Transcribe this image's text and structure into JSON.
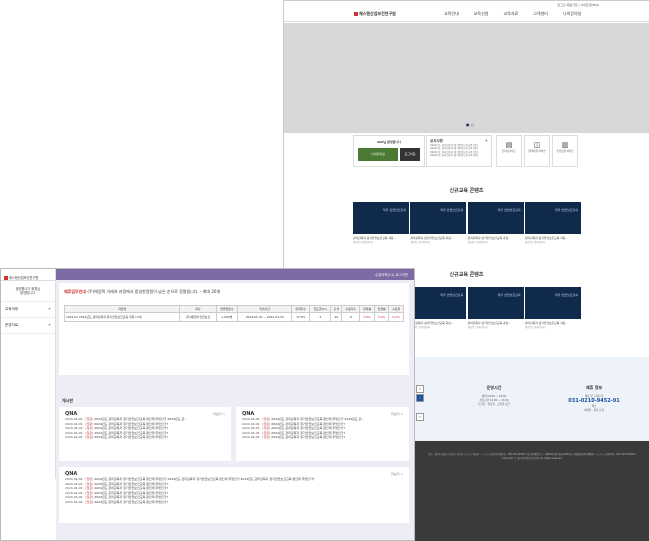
{
  "back": {
    "util": "로그인 회원가입 | 사이트맵    ENG",
    "logo": "제스텐산업보건연구원",
    "menu": [
      "교육안내",
      "교육신청",
      "교육자료",
      "고객센터",
      "나의강의실"
    ],
    "dots": "● ○",
    "quick1": {
      "title": "000님 환영합니다",
      "btn1": "나의강의실",
      "btn2": "로그아웃"
    },
    "quick2": {
      "title": "공지사항",
      "plus": "+",
      "lines": [
        "2024년도 관리감독자 정기안전보건교육 안내",
        "2024년도 관리감독자 정기안전보건교육 안내",
        "2024년도 관리감독자 정기안전보건교육 안내",
        "2024년도 관리감독자 정기안전보건교육 안내"
      ]
    },
    "icons": [
      {
        "glyph": "▤",
        "label": "온라인가이드"
      },
      {
        "glyph": "◫",
        "label": "원격지원 서비스"
      },
      {
        "glyph": "▥",
        "label": "수강신청 서비스"
      }
    ],
    "section1": "신규교육 콘텐츠",
    "section2": "신규교육 콘텐츠",
    "thumbs": [
      {
        "badge": "직무 안전보건교육",
        "cap": "관리감독자 정기안전보건교육 과정...",
        "sub": "제조업 | 관리감독자"
      },
      {
        "badge": "직무 안전보건교육",
        "cap": "관리감독자 정기안전보건교육 과정...",
        "sub": "제조업 | 관리감독자"
      },
      {
        "badge": "직무 안전보건교육",
        "cap": "관리감독자 정기안전보건교육 과정...",
        "sub": "제조업 | 관리감독자"
      },
      {
        "badge": "직무 안전보건교육",
        "cap": "관리감독자 정기안전보건교육 과정...",
        "sub": "제조업 | 관리감독자"
      }
    ],
    "foot": {
      "hours_title": "운영시간",
      "hours_lines": [
        "평일 09:00 ~ 18:00",
        "점심시간 12:00 ~ 13:00",
        "토요일 · 일요일 · 공휴일 휴무"
      ],
      "contact_title": "제휴 정보",
      "contact_sub": "제휴 및 고객문의",
      "tel": "031-0210-9452-91",
      "contact_lines": [
        "팩스",
        "이메일 · 카톡 문의"
      ],
      "dark": "주소 : 경기도 성남시 분당구 판교로 ○○○ | 대표자 : ○○○ | 사업자등록번호 : 000-00-00000 | 통신판매업신고 : 제0000-경기성남-0000호 | 개인정보관리책임자 : ○○○ | 교육문의 : 031-0210-9452 | Copyright ⓒ 제스텐산업보건연구원 All rights reserved."
    }
  },
  "front": {
    "sb_logo": "제스텐산업보건연구원",
    "sb_user": [
      "환영합니다 회원님",
      "환영합니다."
    ],
    "sb_items": [
      {
        "label": "교육과정",
        "sign": "+"
      },
      {
        "label": "운영자료",
        "sign": "+"
      }
    ],
    "topbar_right": "수강이력(11)    로그아웃",
    "notice_prefix": "제휴업무안내",
    "notice_text": "(주)에임텍 거래처 과정에서 합성한정원이 낮은 순으로 정렬됩니다. - 최대 20개",
    "table": {
      "headers": [
        "과정명",
        "회사",
        "연결정원수",
        "학습기간",
        "합격자수",
        "진도율(%)",
        "출석",
        "수료자수",
        "합격률",
        "진행률",
        "수료율"
      ],
      "row": [
        "2024-01 2024년도 관리감독자 정기안전보건교육 과정 (1차)",
        "(주)에임텍 안전보건",
        "1,000명",
        "2024-01-01 ~ 2024-04-30",
        "17.8%",
        "4",
        "29",
        "8",
        "0.0%",
        "0.0%",
        "0.0%"
      ]
    },
    "board_title": "게시판",
    "boards": [
      {
        "title": "QNA",
        "more": "더보기 >",
        "rows": [
          {
            "date": "2024-04-09",
            "tag": "[질문]",
            "text": "2024년도 관리감독자 정기안전보건교육 편인데 무엇인가 2024년도 관..."
          },
          {
            "date": "2024-04-09",
            "tag": "[질문]",
            "text": "2024년도 관리감독자 정기안전보건교육 편인데 무엇인가?"
          },
          {
            "date": "2024-04-09",
            "tag": "[질문]",
            "text": "2024년도 관리감독자 정기안전보건교육 편인데 무엇인가?"
          },
          {
            "date": "2024-04-09",
            "tag": "[질문]",
            "text": "2024년도 관리감독자 정기안전보건교육 편인데 무엇인가?"
          },
          {
            "date": "2024-04-09",
            "tag": "[질문]",
            "text": "2024년도 관리감독자 정기안전보건교육 편인데 무엇인가?"
          }
        ]
      },
      {
        "title": "QNA",
        "more": "더보기 >",
        "rows": [
          {
            "date": "2024-04-09",
            "tag": "[질문]",
            "text": "2024년도 관리감독자 정기안전보건교육 편인데 무엇인가 2024년도 관..."
          },
          {
            "date": "2024-04-09",
            "tag": "[질문]",
            "text": "2024년도 관리감독자 정기안전보건교육 편인데 무엇인가?"
          },
          {
            "date": "2024-04-09",
            "tag": "[질문]",
            "text": "2024년도 관리감독자 정기안전보건교육 편인데 무엇인가?"
          },
          {
            "date": "2024-04-09",
            "tag": "[질문]",
            "text": "2024년도 관리감독자 정기안전보건교육 편인데 무엇인가?"
          },
          {
            "date": "2024-04-09",
            "tag": "[질문]",
            "text": "2024년도 관리감독자 정기안전보건교육 편인데 무엇인가?"
          }
        ]
      },
      {
        "title": "QNA",
        "more": "더보기 >",
        "rows": [
          {
            "date": "2024-04-09",
            "tag": "[질문]",
            "text": "2024년도 관리감독자 정기안전보건교육 편인데 무엇인가 2024년도 관리감독자 정기안전보건교육 편인데 무엇인가 2024년도 관리감독자 정기안전보건교육 편인데 무엇인가?"
          },
          {
            "date": "2024-04-09",
            "tag": "[질문]",
            "text": "2024년도 관리감독자 정기안전보건교육 편인데 무엇인가?"
          },
          {
            "date": "2024-04-09",
            "tag": "[질문]",
            "text": "2024년도 관리감독자 정기안전보건교육 편인데 무엇인가?"
          },
          {
            "date": "2024-04-09",
            "tag": "[질문]",
            "text": "2024년도 관리감독자 정기안전보건교육 편인데 무엇인가?"
          },
          {
            "date": "2024-04-09",
            "tag": "[질문]",
            "text": "2024년도 관리감독자 정기안전보건교육 편인데 무엇인가?"
          },
          {
            "date": "2024-04-09",
            "tag": "[질문]",
            "text": "2024년도 관리감독자 정기안전보건교육 편인데 무엇인가?"
          }
        ]
      }
    ]
  }
}
